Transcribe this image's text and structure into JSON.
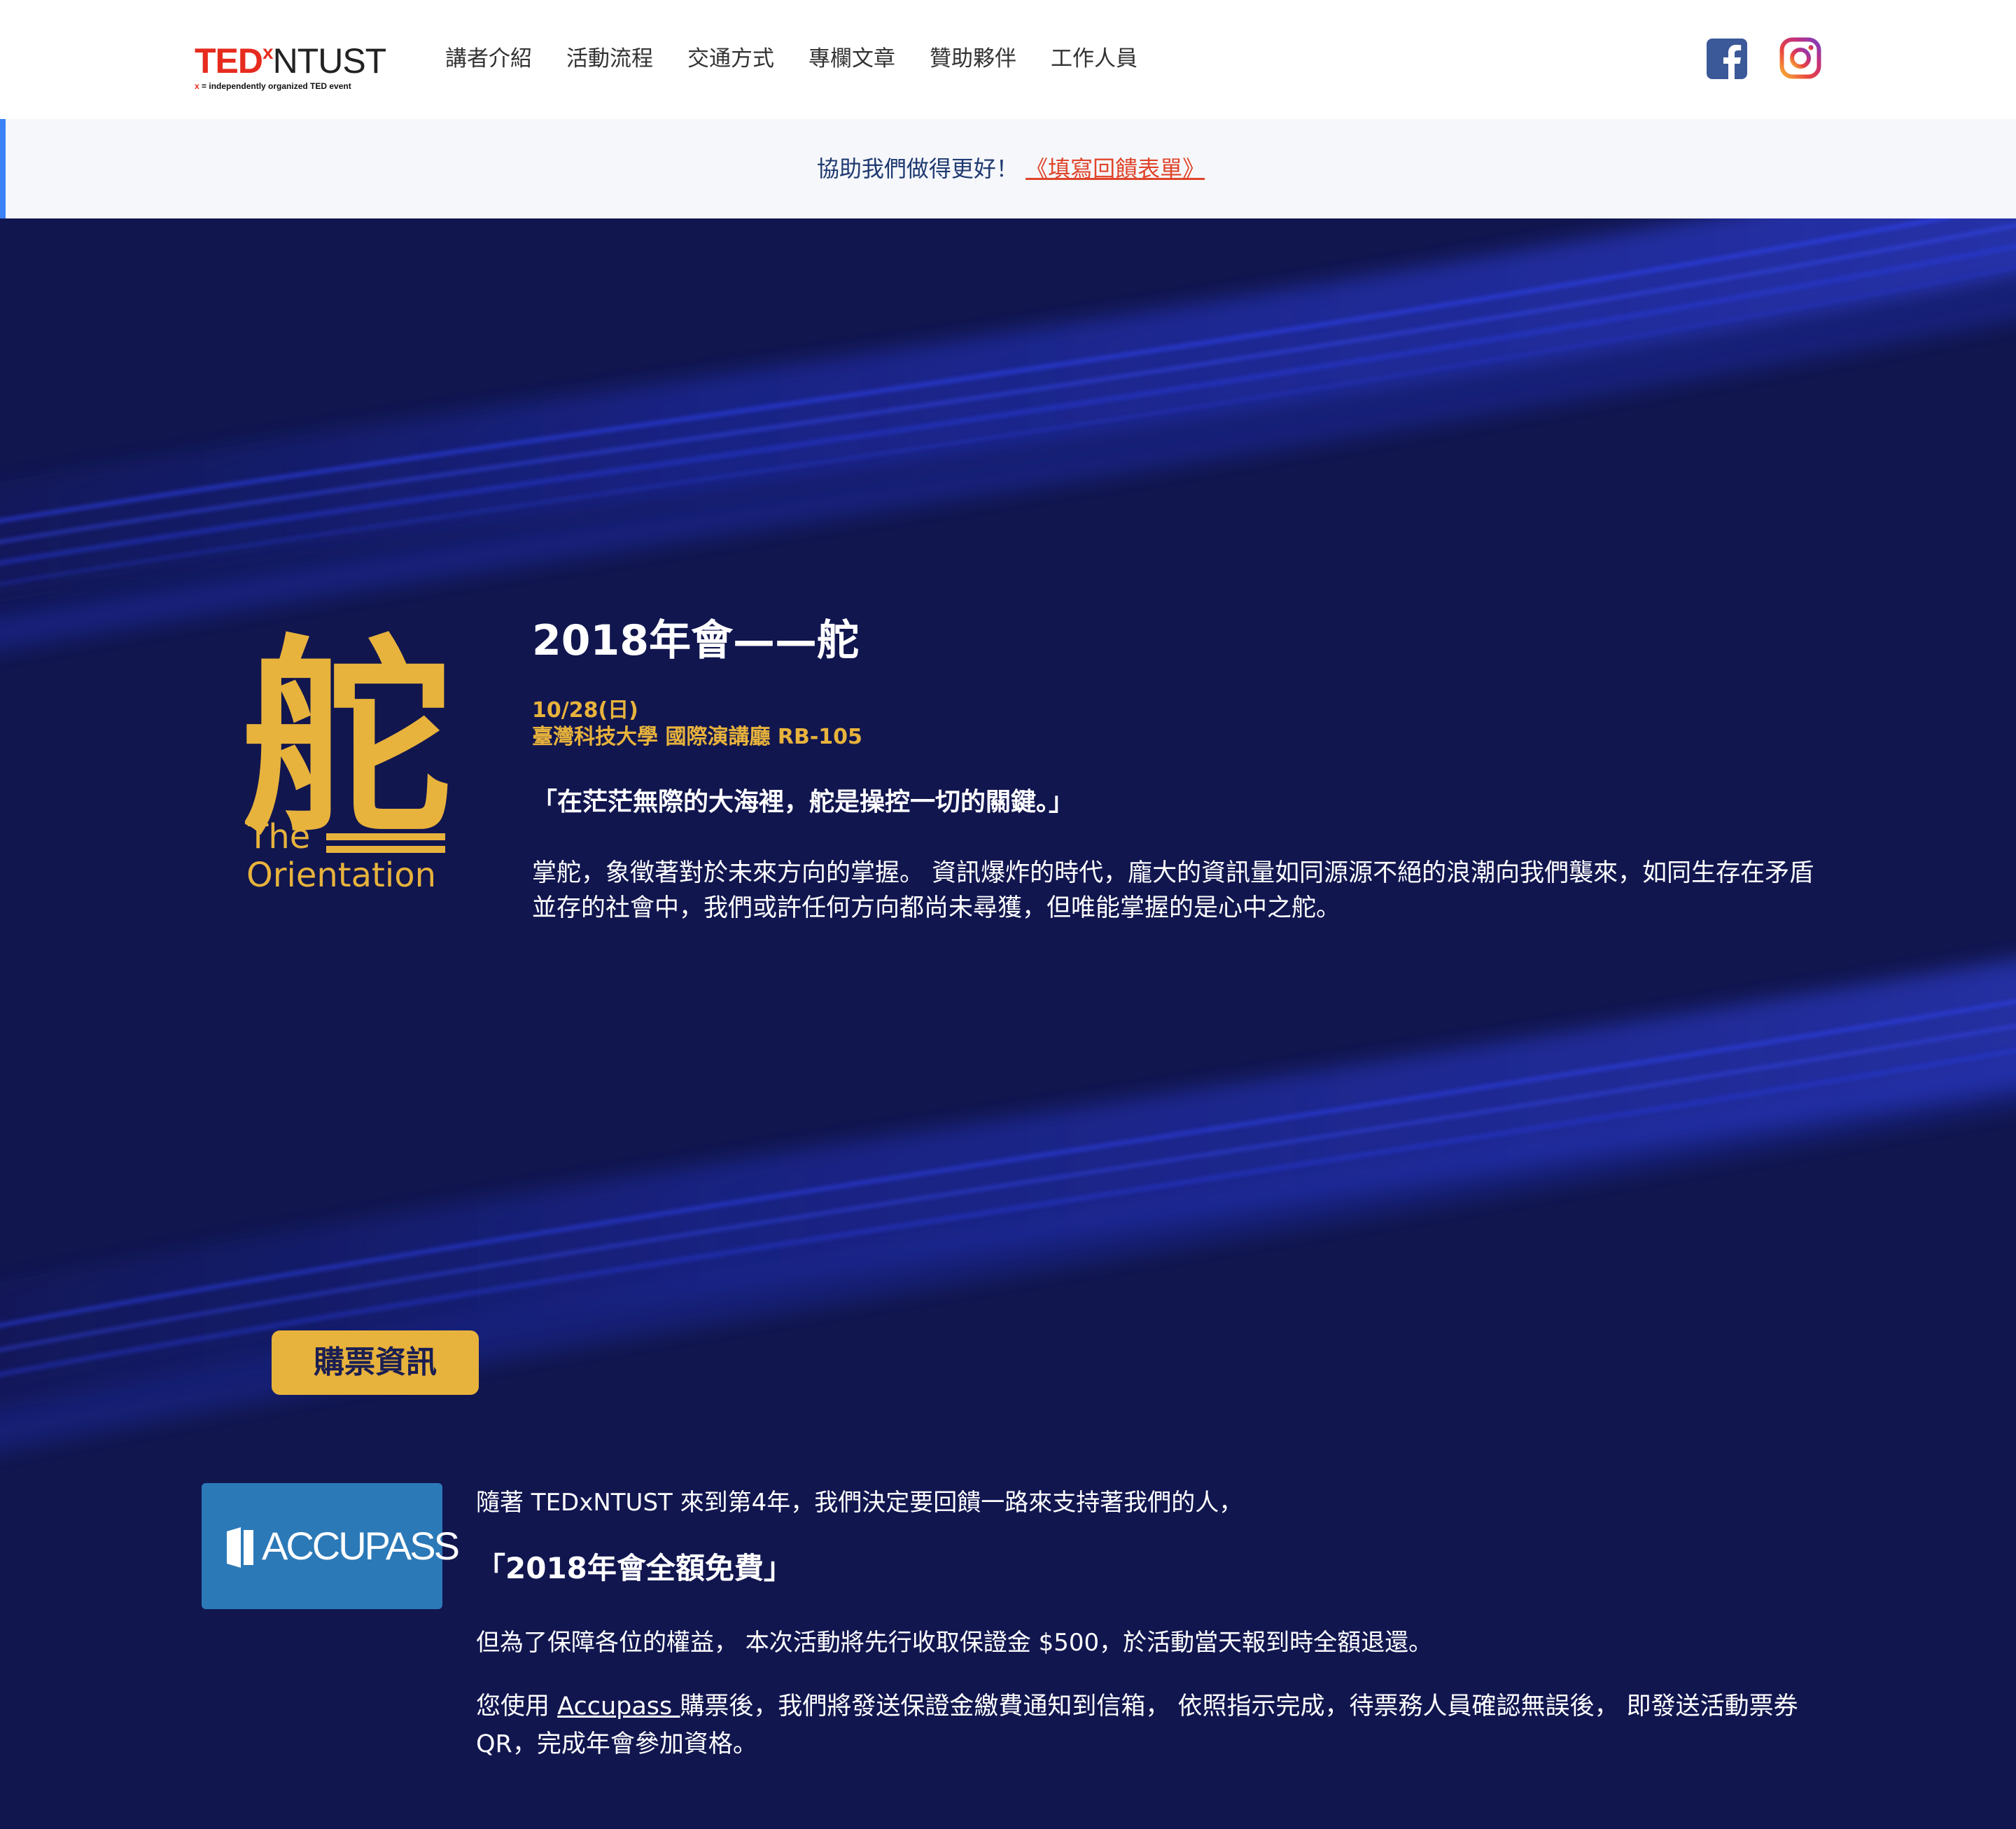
{
  "header": {
    "logo": {
      "brand": "TED",
      "x": "x",
      "event": "NTUST",
      "tagline_x": "x",
      "tagline": " = independently organized TED event"
    },
    "nav": [
      {
        "label": "講者介紹"
      },
      {
        "label": "活動流程"
      },
      {
        "label": "交通方式"
      },
      {
        "label": "專欄文章"
      },
      {
        "label": "贊助夥伴"
      },
      {
        "label": "工作人員"
      }
    ],
    "social": {
      "facebook_icon": "facebook-icon",
      "instagram_icon": "instagram-icon"
    }
  },
  "banner": {
    "text": "協助我們做得更好！",
    "link": "《填寫回饋表單》"
  },
  "event": {
    "logo_char": "舵",
    "logo_line1": "The",
    "logo_line2": "Orientation",
    "title": "2018年會——舵",
    "date": "10/28(日)",
    "venue": "臺灣科技大學 國際演講廳 RB-105",
    "quote": "「在茫茫無際的大海裡，舵是操控一切的關鍵。」",
    "description": "掌舵，象徵著對於未來方向的掌握。 資訊爆炸的時代，龐大的資訊量如同源源不絕的浪潮向我們襲來，如同生存在矛盾並存的社會中，我們或許任何方向都尚未尋獲，但唯能掌握的是心中之舵。"
  },
  "tickets": {
    "heading": "購票資訊",
    "partner_logo": "ACCUPASS",
    "line1": "隨著 TEDxNTUST 來到第4年，我們決定要回饋一路來支持著我們的人，",
    "free_notice": "「2018年會全額免費」",
    "line2": "但為了保障各位的權益， 本次活動將先行收取保證金 $500，於活動當天報到時全額退還。",
    "line3_pre": "您使用 ",
    "line3_link": "Accupass ",
    "line3_post": "購票後，我們將發送保證金繳費通知到信箱， 依照指示完成，待票務人員確認無誤後， 即發送活動票券QR，完成年會參加資格。"
  },
  "colors": {
    "page_bg": "#11164f",
    "accent_gold": "#e8b33c",
    "ted_red": "#e62b1e",
    "banner_bg": "#f5f7fb",
    "banner_link": "#e0452b",
    "accupass_blue": "#2c79b8",
    "facebook_blue": "#3b5998"
  }
}
